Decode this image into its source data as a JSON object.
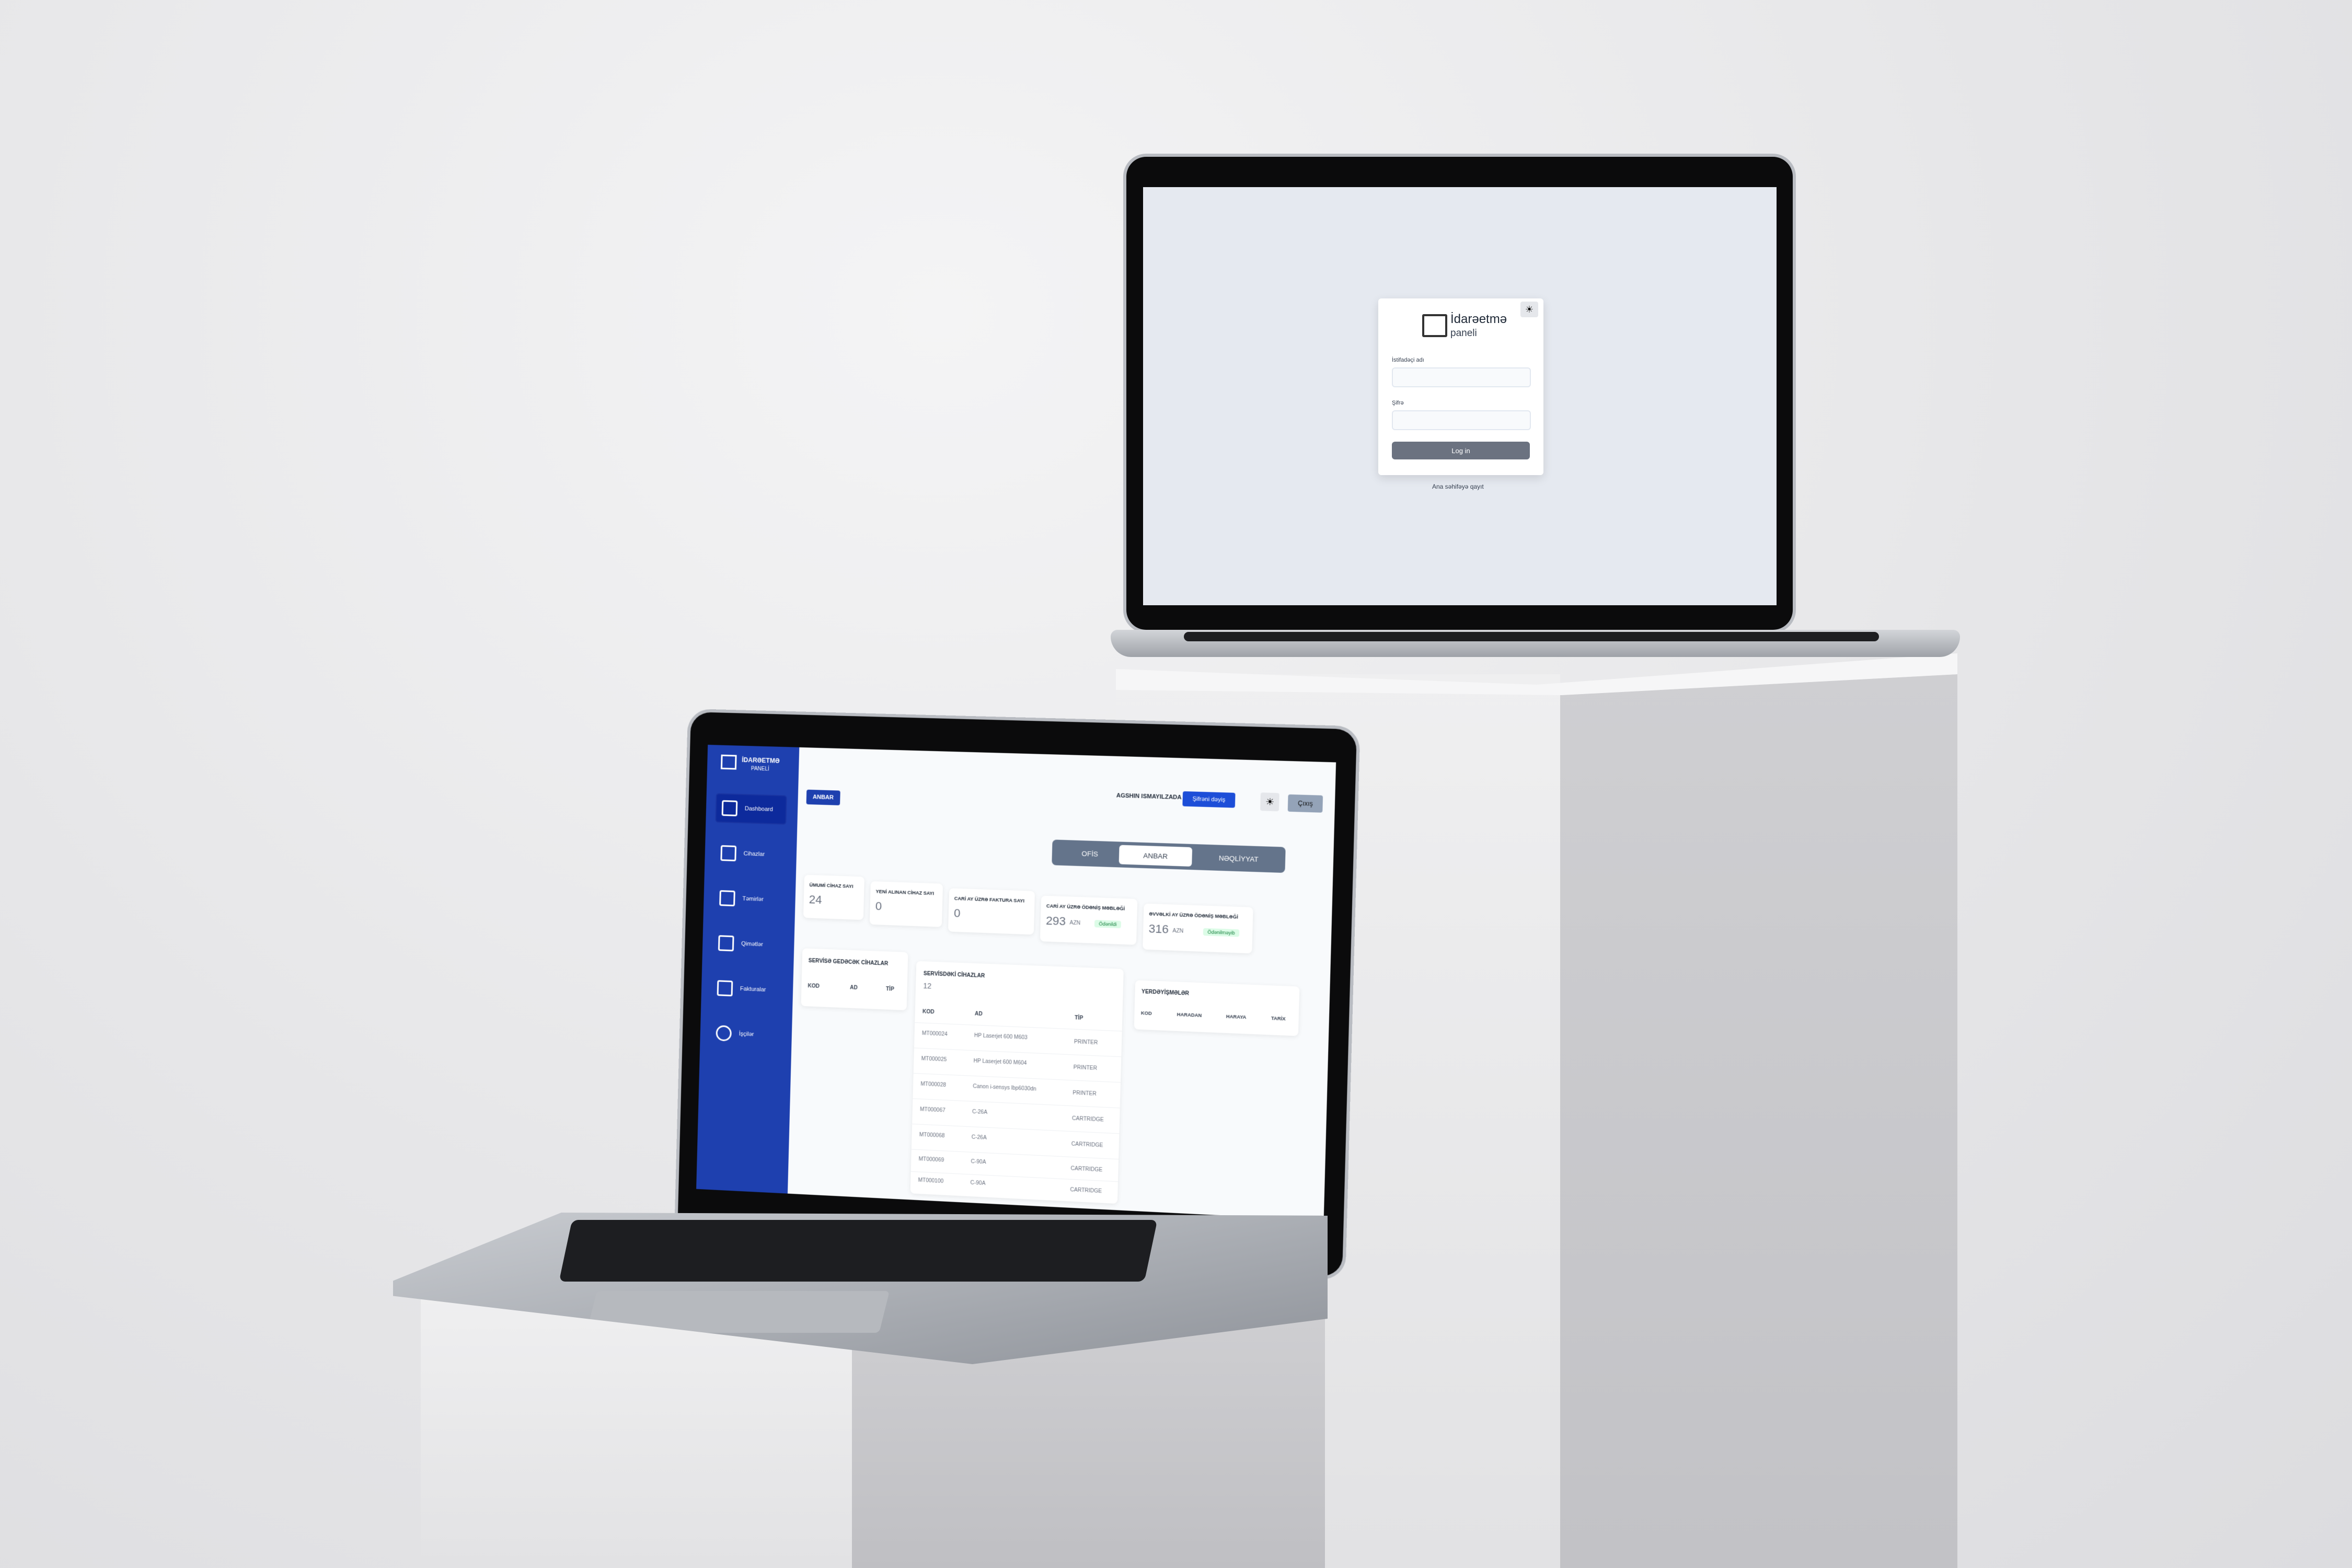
{
  "login": {
    "title_line1": "İdarəetmə",
    "title_line2": "paneli",
    "theme_icon": "sun-icon",
    "username_label": "İstifadəçi adı",
    "password_label": "Şifrə",
    "login_button": "Log in",
    "back_link": "Ana səhifəyə qayıt"
  },
  "dashboard": {
    "brand_line1": "İDARƏETMƏ",
    "brand_line2": "PANELİ",
    "sidebar": [
      {
        "label": "Dashboard",
        "icon": "chart-icon"
      },
      {
        "label": "Cihazlar",
        "icon": "device-icon"
      },
      {
        "label": "Təmirlər",
        "icon": "repair-icon"
      },
      {
        "label": "Qimətlər",
        "icon": "invoice-icon"
      },
      {
        "label": "Fakturalar",
        "icon": "card-icon"
      },
      {
        "label": "İşçilər",
        "icon": "users-icon"
      }
    ],
    "header": {
      "section_badge": "ANBAR",
      "user_name": "AGSHIN ISMAYILZADA",
      "change_password": "Şifrəni dəyiş",
      "theme_icon": "sun-icon",
      "logout": "Çıxış"
    },
    "tabs": [
      "OFİS",
      "ANBAR",
      "NƏQLİYYAT"
    ],
    "active_tab": "ANBAR",
    "stats": [
      {
        "title": "ÜMUMİ CİHAZ SAYI",
        "value": "24"
      },
      {
        "title": "YENİ ALINAN CİHAZ SAYI",
        "value": "0"
      },
      {
        "title": "CARİ AY ÜZRƏ FAKTURA SAYI",
        "value": "0"
      },
      {
        "title": "CARİ AY ÜZRƏ ÖDƏNİŞ MƏBLƏĞİ",
        "value": "293",
        "unit": "AZN",
        "badge": "Ödənildi"
      },
      {
        "title": "ƏVVƏLKİ AY ÜZRƏ ÖDƏNİŞ MƏBLƏĞİ",
        "value": "316",
        "unit": "AZN",
        "badge": "Ödənilməyib"
      }
    ],
    "service_going": {
      "title": "SERVİSƏ GEDƏCƏK CİHAZLAR",
      "columns": [
        "KOD",
        "AD",
        "TİP"
      ]
    },
    "in_service": {
      "title": "SERVİSDƏKİ CİHAZLAR",
      "count": "12",
      "columns": [
        "KOD",
        "AD",
        "TİP"
      ],
      "rows": [
        [
          "MT000024",
          "HP Laserjet 600 M603",
          "PRINTER"
        ],
        [
          "MT000025",
          "HP Laserjet 600 M604",
          "PRINTER"
        ],
        [
          "MT000028",
          "Canon i-sensys lbp6030dn",
          "PRINTER"
        ],
        [
          "MT000067",
          "C-26A",
          "CARTRIDGE"
        ],
        [
          "MT000068",
          "C-26A",
          "CARTRIDGE"
        ],
        [
          "MT000069",
          "C-90A",
          "CARTRIDGE"
        ],
        [
          "MT000100",
          "C-90A",
          "CARTRIDGE"
        ]
      ]
    },
    "transfers": {
      "title": "YERDƏYİŞMƏLƏR",
      "columns": [
        "KOD",
        "HARADAN",
        "HARAYA",
        "TARİX"
      ]
    }
  },
  "colors": {
    "sidebar_blue": "#1e40af",
    "primary_blue": "#1d4ed8",
    "login_bg": "#e5e9f0",
    "tab_gray": "#64748b"
  }
}
